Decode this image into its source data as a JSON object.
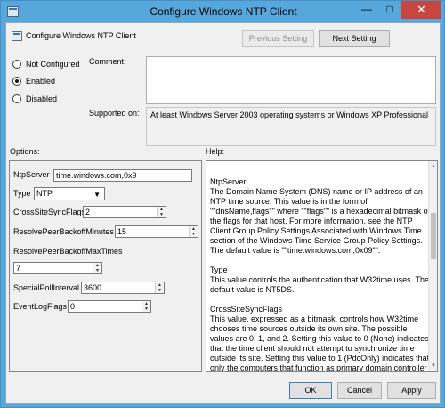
{
  "window": {
    "title": "Configure Windows NTP Client",
    "minimize": "—",
    "maximize": "□",
    "close": "✕"
  },
  "header": {
    "title": "Configure Windows NTP Client",
    "prev_label": "Previous Setting",
    "next_label": "Next Setting"
  },
  "state": {
    "options": [
      "Not Configured",
      "Enabled",
      "Disabled"
    ],
    "selected": "Enabled"
  },
  "comment_label": "Comment:",
  "supported_label": "Supported on:",
  "supported_value": "At least Windows Server 2003 operating systems or Windows XP Professional",
  "options_label": "Options:",
  "help_label": "Help:",
  "fields": {
    "ntpserver_label": "NtpServer",
    "ntpserver_value": "time.windows.com,0x9",
    "type_label": "Type",
    "type_value": "NTP",
    "crosssite_label": "CrossSiteSyncFlags",
    "crosssite_value": "2",
    "resolvebackoffmin_label": "ResolvePeerBackoffMinutes",
    "resolvebackoffmin_value": "15",
    "resolvebackoffmax_label": "ResolvePeerBackoffMaxTimes",
    "resolvebackoffmax_value": "7",
    "specialpoll_label": "SpecialPollInterval",
    "specialpoll_value": "3600",
    "eventlog_label": "EventLogFlags",
    "eventlog_value": "0"
  },
  "help": [
    {
      "head": "NtpServer",
      "body": "The Domain Name System (DNS) name or IP address of an NTP time source. This value is in the form of \"\"dnsName,flags\"\" where \"\"flags\"\" is a hexadecimal bitmask of the flags for that host. For more information, see the NTP Client Group Policy Settings Associated with Windows Time section of the Windows Time Service Group Policy Settings.  The default value is \"\"time.windows.com,0x09\"\"."
    },
    {
      "head": "Type",
      "body": "This value controls the authentication that W32time uses. The default value is NT5DS."
    },
    {
      "head": "CrossSiteSyncFlags",
      "body": "This value, expressed as a bitmask, controls how W32time chooses time sources outside its own site. The possible values are 0, 1, and 2. Setting this value to 0 (None) indicates that the time client should not attempt to synchronize time outside its site. Setting this value to 1 (PdcOnly) indicates that only the computers that function as primary domain controller (PDC)"
    }
  ],
  "footer": {
    "ok_label": "OK",
    "cancel_label": "Cancel",
    "apply_label": "Apply"
  },
  "icons": {
    "policy": "policy-icon",
    "dropdown": "chevron-down-icon"
  },
  "colors": {
    "title_bar": "#56a8dc",
    "close_button": "#c7463f",
    "dialog_background": "#f0f0f0"
  }
}
